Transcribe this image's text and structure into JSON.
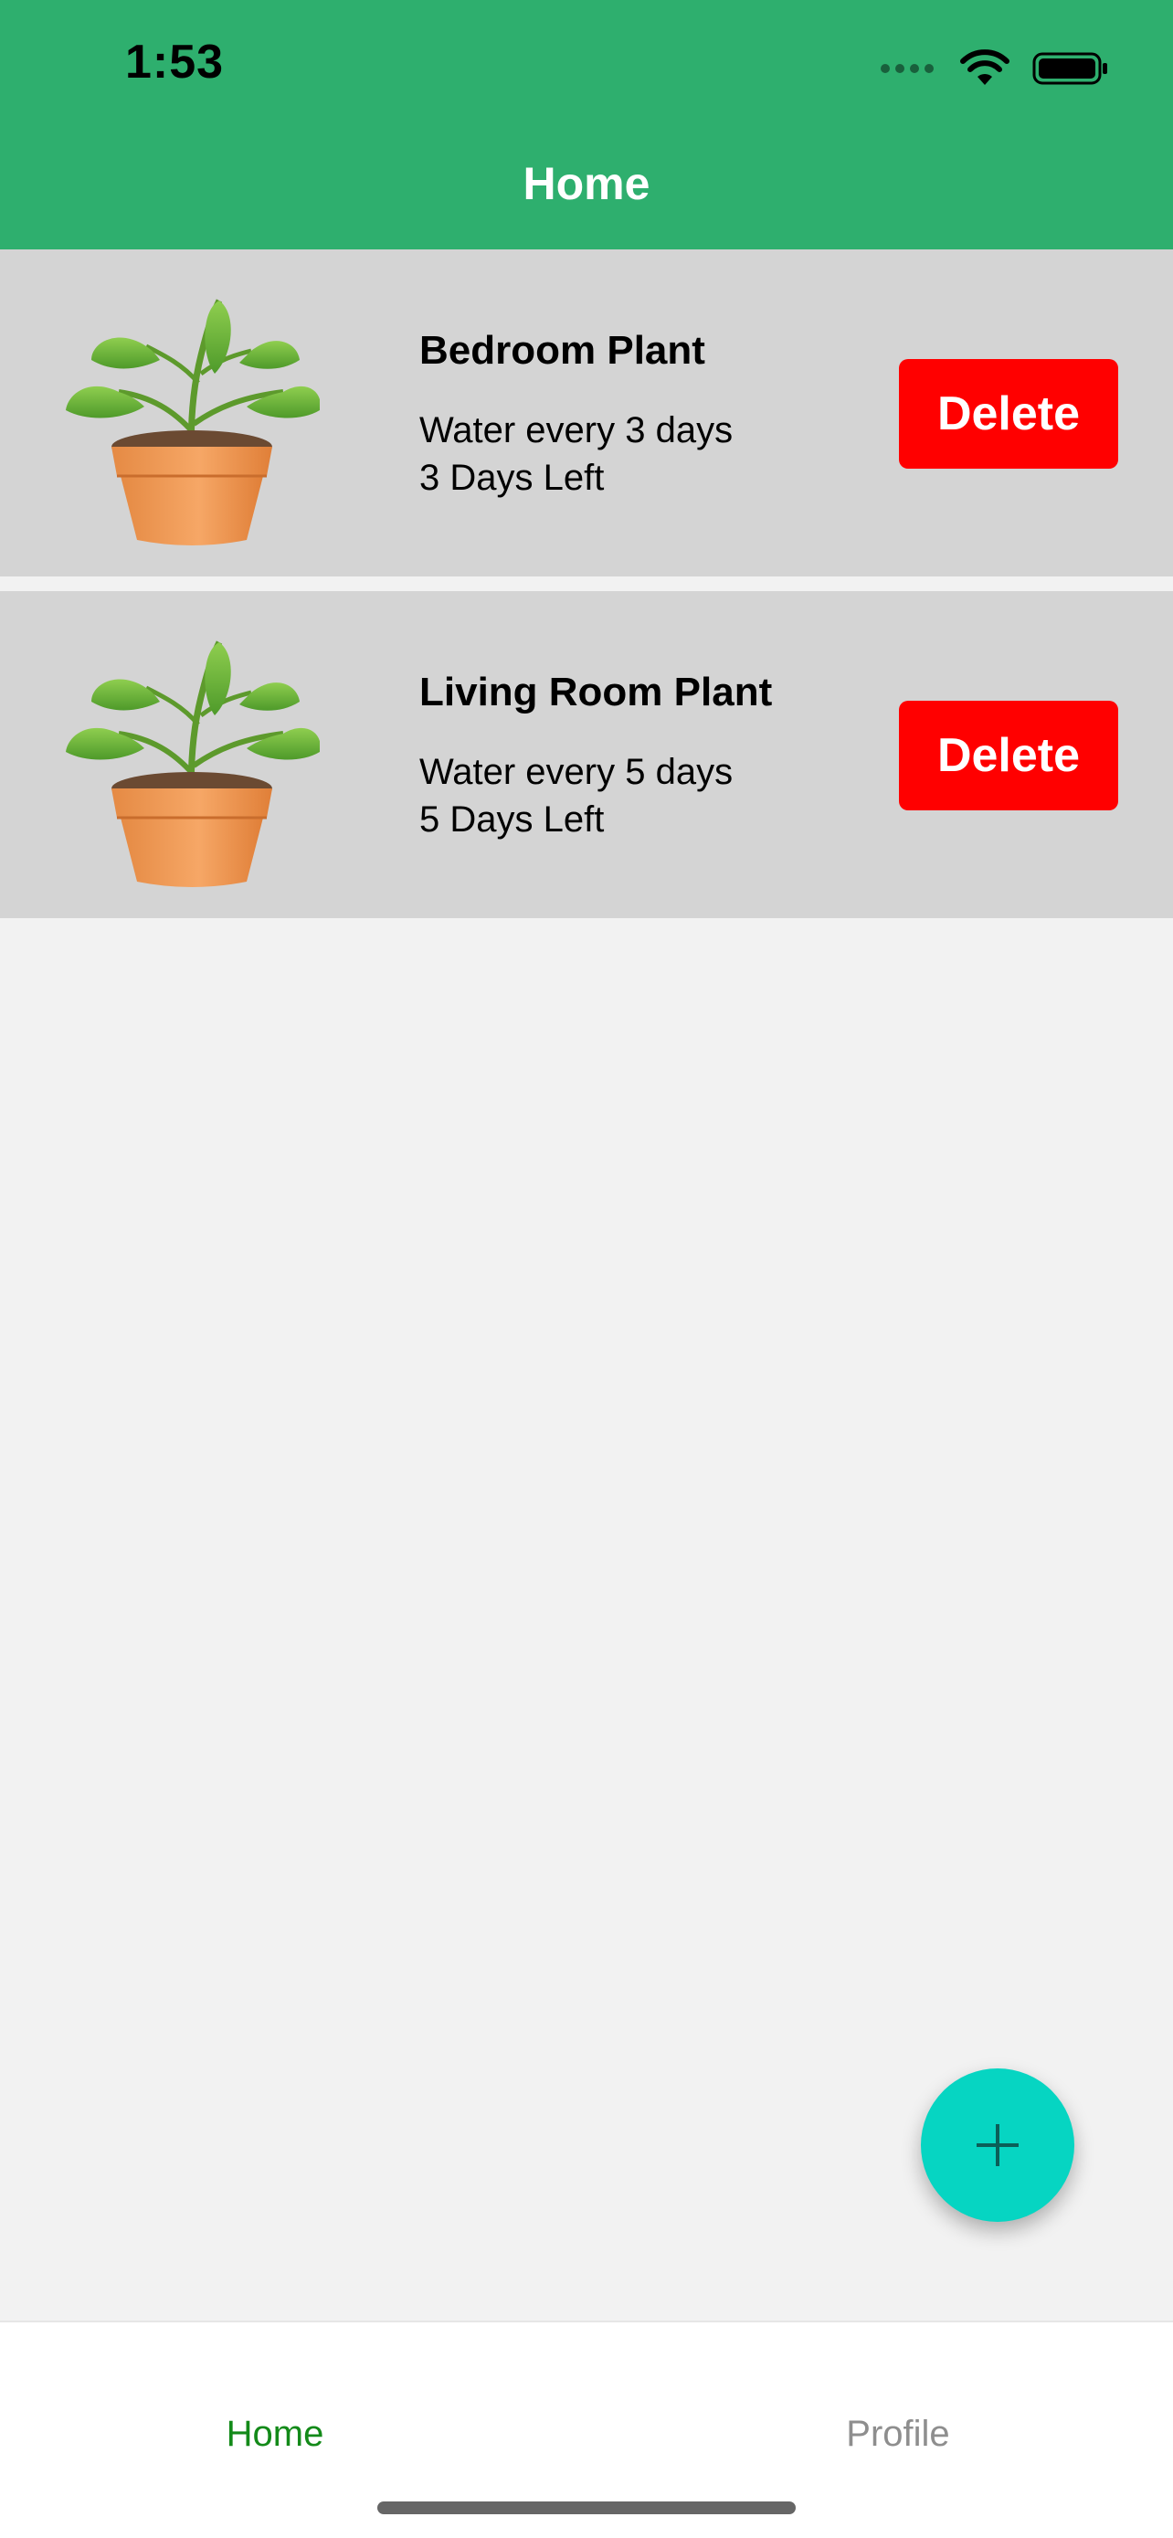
{
  "status_bar": {
    "time": "1:53",
    "icons": [
      "signal-icon",
      "wifi-icon",
      "battery-icon"
    ]
  },
  "nav": {
    "title": "Home"
  },
  "plants": [
    {
      "name": "Bedroom Plant",
      "frequency": "Water every 3 days",
      "remaining": "3 Days Left",
      "delete_label": "Delete",
      "icon": "potted-plant-icon"
    },
    {
      "name": "Living Room Plant",
      "frequency": "Water every 5 days",
      "remaining": "5 Days Left",
      "delete_label": "Delete",
      "icon": "potted-plant-icon"
    }
  ],
  "fab": {
    "icon": "plus-icon"
  },
  "tabbar": {
    "home_label": "Home",
    "profile_label": "Profile"
  },
  "colors": {
    "header": "#2eaf6e",
    "card": "#d4d4d4",
    "delete": "#ff0000",
    "fab": "#06d5c2",
    "tab_active": "#138a19",
    "tab_inactive": "#8e8e8e"
  }
}
